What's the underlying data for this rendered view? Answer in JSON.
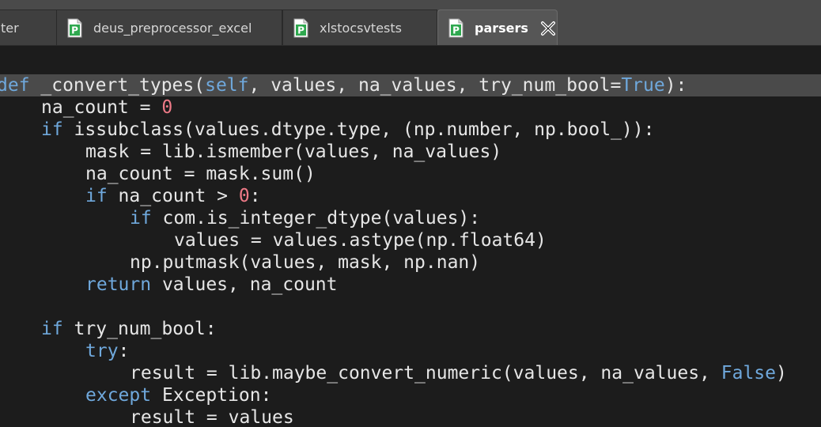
{
  "tabs": [
    {
      "label": "ter",
      "active": false
    },
    {
      "label": "deus_preprocessor_excel",
      "active": false
    },
    {
      "label": "xlstocsvtests",
      "active": false
    },
    {
      "label": "parsers",
      "active": true
    }
  ],
  "icons": {
    "file": "pycharm-file-icon",
    "close": "close-icon"
  },
  "colors": {
    "keyword": "#6fa8dc",
    "number": "#ee7a87",
    "text": "#e6e6e6",
    "highlight": "#4a4a4a"
  },
  "code_lines": [
    {
      "indent": 0,
      "tokens": [
        [
          "kw",
          "def"
        ],
        [
          "t",
          " _convert_types("
        ],
        [
          "kw",
          "self"
        ],
        [
          "t",
          ", values, na_values, try_num_bool="
        ],
        [
          "kw",
          "True"
        ],
        [
          "t",
          "):"
        ]
      ],
      "highlight": true
    },
    {
      "indent": 1,
      "tokens": [
        [
          "t",
          "na_count = "
        ],
        [
          "num",
          "0"
        ]
      ]
    },
    {
      "indent": 1,
      "tokens": [
        [
          "kw",
          "if"
        ],
        [
          "t",
          " issubclass(values.dtype.type, (np.number, np.bool_)):"
        ]
      ]
    },
    {
      "indent": 2,
      "tokens": [
        [
          "t",
          "mask = lib.ismember(values, na_values)"
        ]
      ]
    },
    {
      "indent": 2,
      "tokens": [
        [
          "t",
          "na_count = mask.sum()"
        ]
      ]
    },
    {
      "indent": 2,
      "tokens": [
        [
          "kw",
          "if"
        ],
        [
          "t",
          " na_count > "
        ],
        [
          "num",
          "0"
        ],
        [
          "t",
          ":"
        ]
      ]
    },
    {
      "indent": 3,
      "tokens": [
        [
          "kw",
          "if"
        ],
        [
          "t",
          " com.is_integer_dtype(values):"
        ]
      ]
    },
    {
      "indent": 4,
      "tokens": [
        [
          "t",
          "values = values.astype(np.float64)"
        ]
      ]
    },
    {
      "indent": 3,
      "tokens": [
        [
          "t",
          "np.putmask(values, mask, np.nan)"
        ]
      ]
    },
    {
      "indent": 2,
      "tokens": [
        [
          "kw",
          "return"
        ],
        [
          "t",
          " values, na_count"
        ]
      ]
    },
    {
      "indent": 0,
      "tokens": []
    },
    {
      "indent": 1,
      "tokens": [
        [
          "kw",
          "if"
        ],
        [
          "t",
          " try_num_bool:"
        ]
      ]
    },
    {
      "indent": 2,
      "tokens": [
        [
          "kw",
          "try"
        ],
        [
          "t",
          ":"
        ]
      ]
    },
    {
      "indent": 3,
      "tokens": [
        [
          "t",
          "result = lib.maybe_convert_numeric(values, na_values, "
        ],
        [
          "kw",
          "False"
        ],
        [
          "t",
          ")"
        ]
      ]
    },
    {
      "indent": 2,
      "tokens": [
        [
          "kw",
          "except"
        ],
        [
          "t",
          " Exception:"
        ]
      ]
    },
    {
      "indent": 3,
      "tokens": [
        [
          "t",
          "result = values"
        ]
      ]
    }
  ]
}
